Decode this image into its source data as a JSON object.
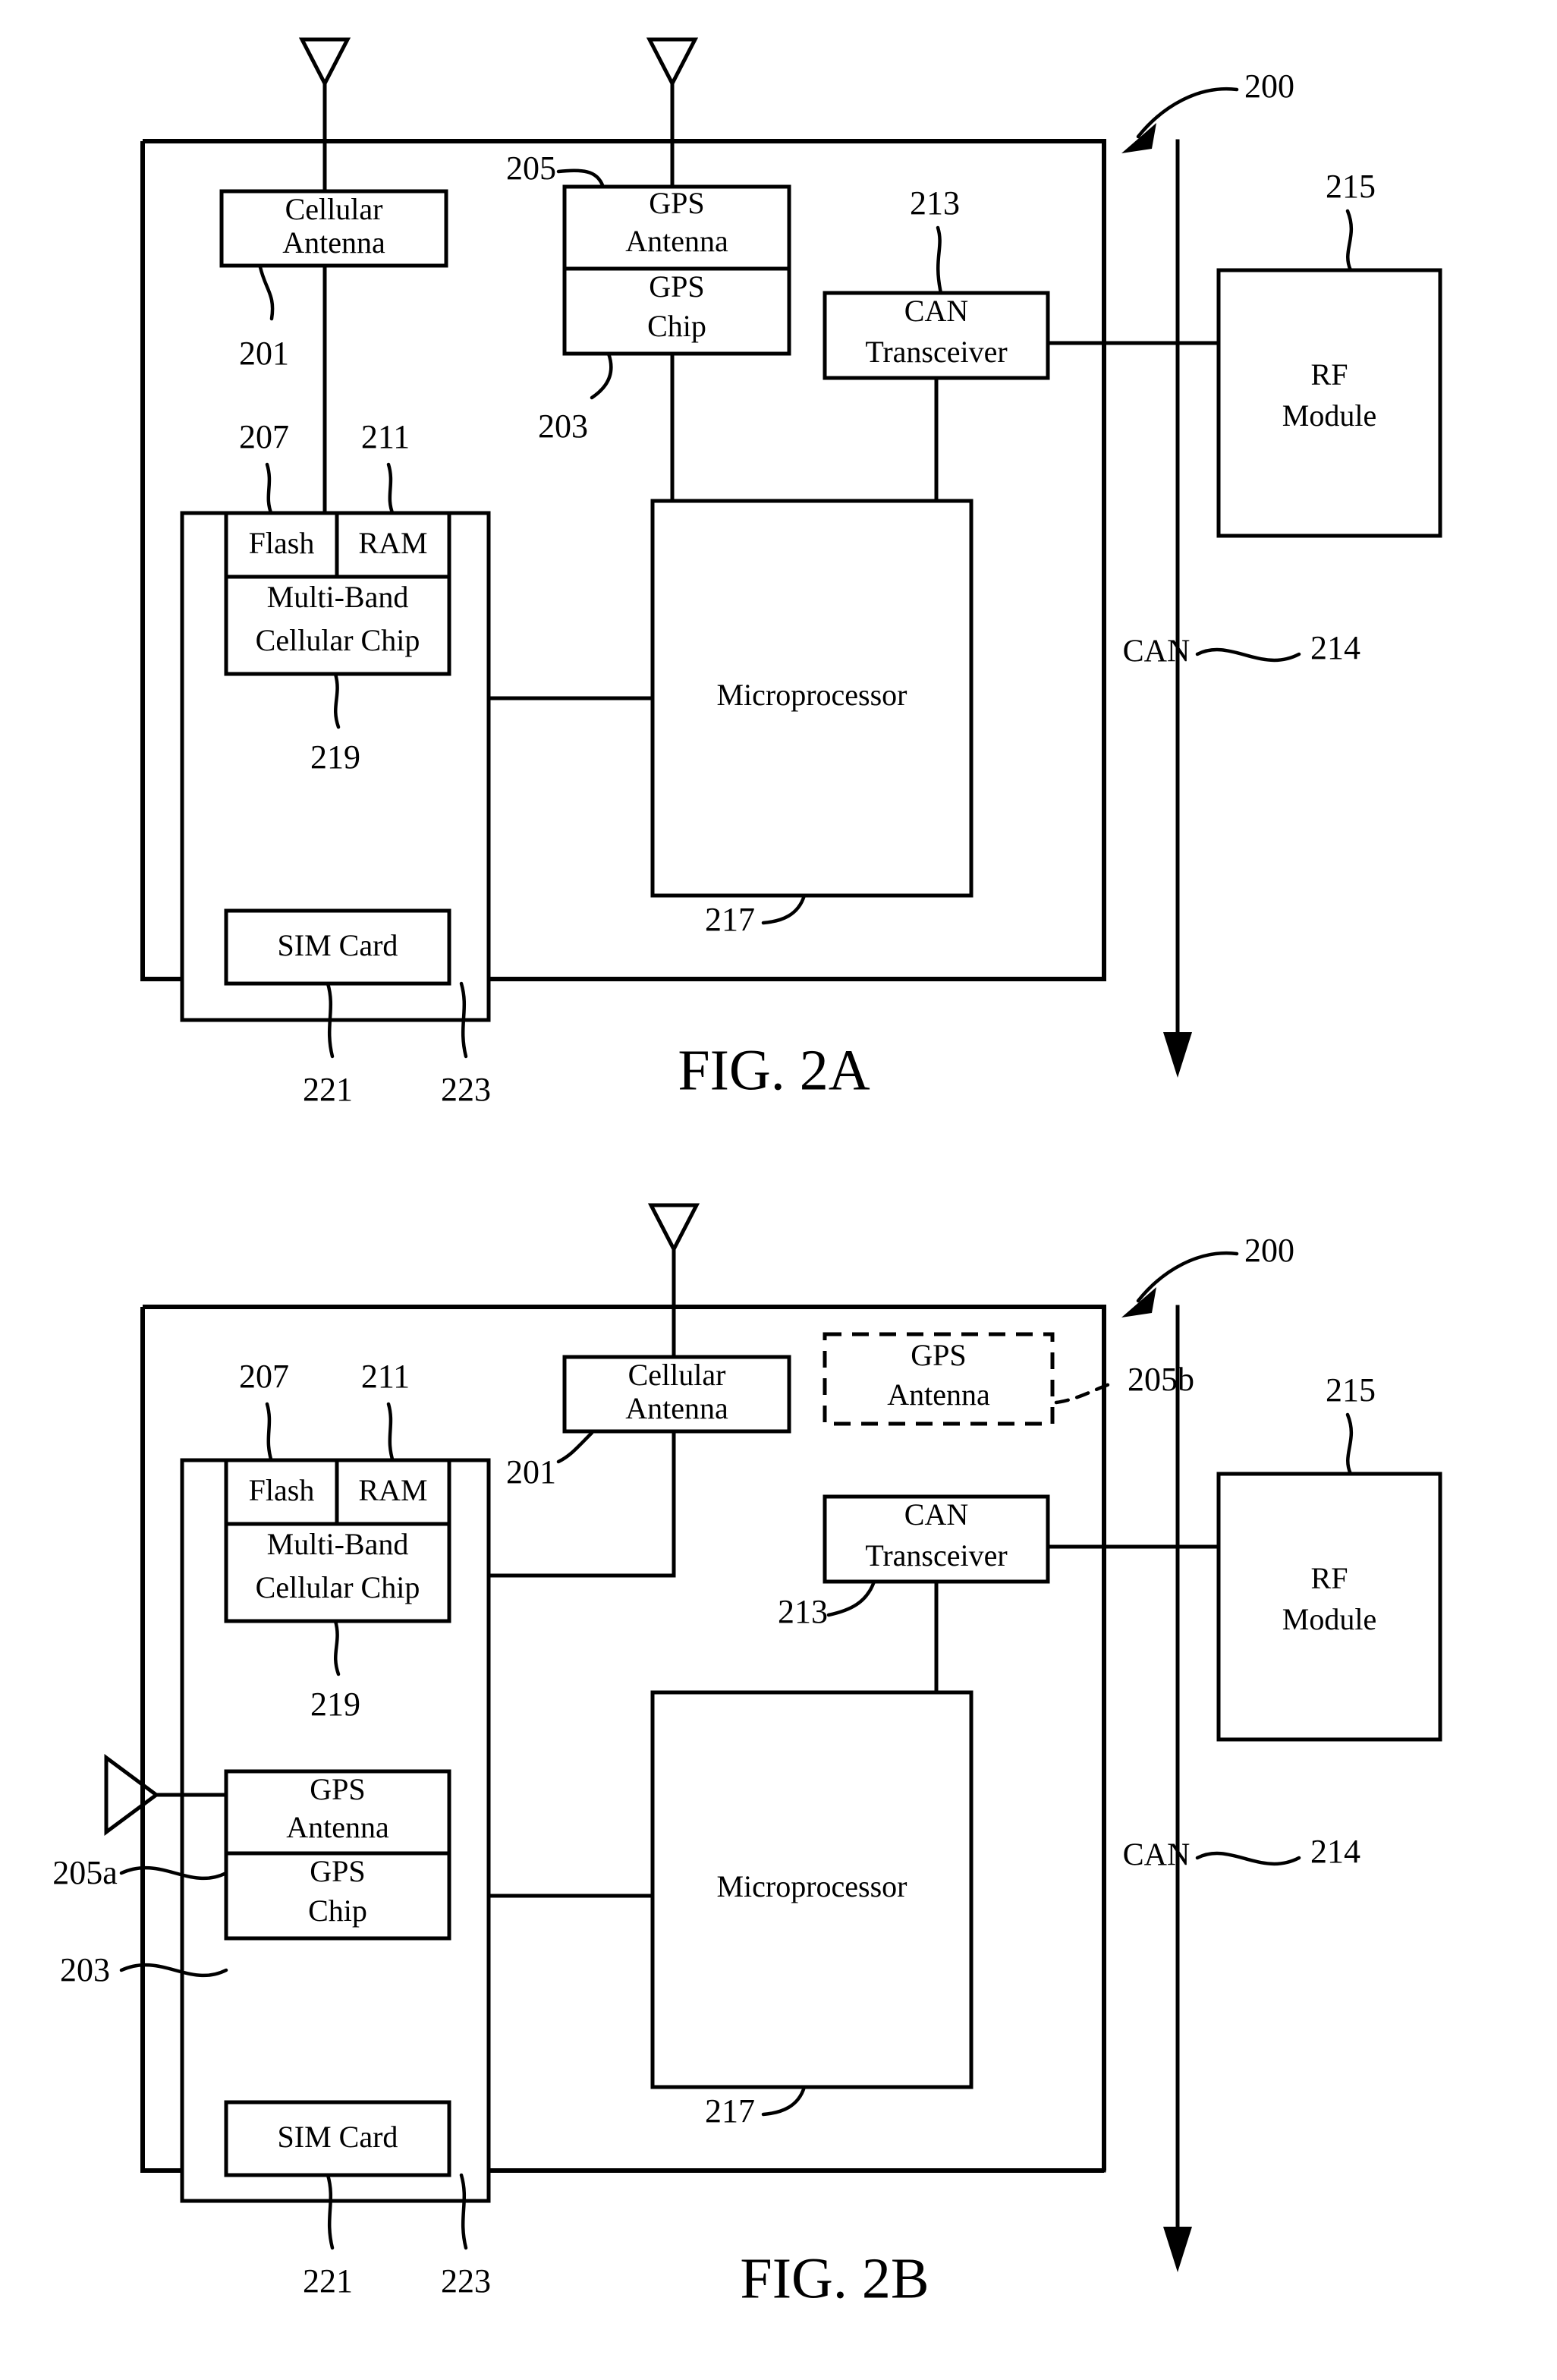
{
  "document": {
    "type": "patent-drawing-sheet",
    "figures": [
      {
        "id": "fig2a",
        "caption": "FIG. 2A",
        "system_ref": "200",
        "blocks": [
          {
            "name": "cellular-antenna",
            "label_line1": "Cellular",
            "label_line2": "Antenna",
            "ref": "201"
          },
          {
            "name": "gps-antenna",
            "label_line1": "GPS",
            "label_line2": "Antenna",
            "ref": "205"
          },
          {
            "name": "gps-chip",
            "label_line1": "GPS",
            "label_line2": "Chip",
            "ref": "203"
          },
          {
            "name": "can-transceiver",
            "label_line1": "CAN",
            "label_line2": "Transceiver",
            "ref": "213"
          },
          {
            "name": "rf-module",
            "label_line1": "RF",
            "label_line2": "Module",
            "ref": "215"
          },
          {
            "name": "flash",
            "label_line1": "Flash",
            "label_line2": "",
            "ref": "207"
          },
          {
            "name": "ram",
            "label_line1": "RAM",
            "label_line2": "",
            "ref": "211"
          },
          {
            "name": "multi-band-cellular-chip",
            "label_line1": "Multi-Band",
            "label_line2": "Cellular Chip",
            "ref": "219"
          },
          {
            "name": "microprocessor",
            "label_line1": "Microprocessor",
            "label_line2": "",
            "ref": "217"
          },
          {
            "name": "sim-card",
            "label_line1": "SIM Card",
            "label_line2": "",
            "ref": "221"
          }
        ],
        "bus": {
          "label": "CAN",
          "ref": "214"
        },
        "extra_refs": [
          "223"
        ]
      },
      {
        "id": "fig2b",
        "caption": "FIG. 2B",
        "system_ref": "200",
        "blocks": [
          {
            "name": "cellular-antenna",
            "label_line1": "Cellular",
            "label_line2": "Antenna",
            "ref": "201"
          },
          {
            "name": "gps-antenna-external",
            "label_line1": "GPS",
            "label_line2": "Antenna",
            "ref": "205b",
            "style": "dashed"
          },
          {
            "name": "gps-antenna-internal",
            "label_line1": "GPS",
            "label_line2": "Antenna",
            "ref": "205a"
          },
          {
            "name": "gps-chip",
            "label_line1": "GPS",
            "label_line2": "Chip",
            "ref": "203"
          },
          {
            "name": "can-transceiver",
            "label_line1": "CAN",
            "label_line2": "Transceiver",
            "ref": "213"
          },
          {
            "name": "rf-module",
            "label_line1": "RF",
            "label_line2": "Module",
            "ref": "215"
          },
          {
            "name": "flash",
            "label_line1": "Flash",
            "label_line2": "",
            "ref": "207"
          },
          {
            "name": "ram",
            "label_line1": "RAM",
            "label_line2": "",
            "ref": "211"
          },
          {
            "name": "multi-band-cellular-chip",
            "label_line1": "Multi-Band",
            "label_line2": "Cellular Chip",
            "ref": "219"
          },
          {
            "name": "microprocessor",
            "label_line1": "Microprocessor",
            "label_line2": "",
            "ref": "217"
          },
          {
            "name": "sim-card",
            "label_line1": "SIM Card",
            "label_line2": "",
            "ref": "221"
          }
        ],
        "bus": {
          "label": "CAN",
          "ref": "214"
        },
        "extra_refs": [
          "223"
        ]
      }
    ]
  },
  "fig2a": {
    "caption": "FIG. 2A",
    "ref_200": "200",
    "ref_201": "201",
    "ref_203": "203",
    "ref_205": "205",
    "ref_207": "207",
    "ref_211": "211",
    "ref_213": "213",
    "ref_214": "214",
    "ref_215": "215",
    "ref_217": "217",
    "ref_219": "219",
    "ref_221": "221",
    "ref_223": "223",
    "cellular_antenna_l1": "Cellular",
    "cellular_antenna_l2": "Antenna",
    "gps_antenna_l1": "GPS",
    "gps_antenna_l2": "Antenna",
    "gps_chip_l1": "GPS",
    "gps_chip_l2": "Chip",
    "can_transceiver_l1": "CAN",
    "can_transceiver_l2": "Transceiver",
    "rf_module_l1": "RF",
    "rf_module_l2": "Module",
    "flash": "Flash",
    "ram": "RAM",
    "mbcc_l1": "Multi-Band",
    "mbcc_l2": "Cellular Chip",
    "microprocessor": "Microprocessor",
    "sim_card": "SIM Card",
    "bus_label": "CAN"
  },
  "fig2b": {
    "caption": "FIG. 2B",
    "ref_200": "200",
    "ref_201": "201",
    "ref_203": "203",
    "ref_205a": "205a",
    "ref_205b": "205b",
    "ref_207": "207",
    "ref_211": "211",
    "ref_213": "213",
    "ref_214": "214",
    "ref_215": "215",
    "ref_217": "217",
    "ref_219": "219",
    "ref_221": "221",
    "ref_223": "223",
    "cellular_antenna_l1": "Cellular",
    "cellular_antenna_l2": "Antenna",
    "gps_antenna_ext_l1": "GPS",
    "gps_antenna_ext_l2": "Antenna",
    "gps_antenna_int_l1": "GPS",
    "gps_antenna_int_l2": "Antenna",
    "gps_chip_l1": "GPS",
    "gps_chip_l2": "Chip",
    "can_transceiver_l1": "CAN",
    "can_transceiver_l2": "Transceiver",
    "rf_module_l1": "RF",
    "rf_module_l2": "Module",
    "flash": "Flash",
    "ram": "RAM",
    "mbcc_l1": "Multi-Band",
    "mbcc_l2": "Cellular Chip",
    "microprocessor": "Microprocessor",
    "sim_card": "SIM Card",
    "bus_label": "CAN"
  }
}
